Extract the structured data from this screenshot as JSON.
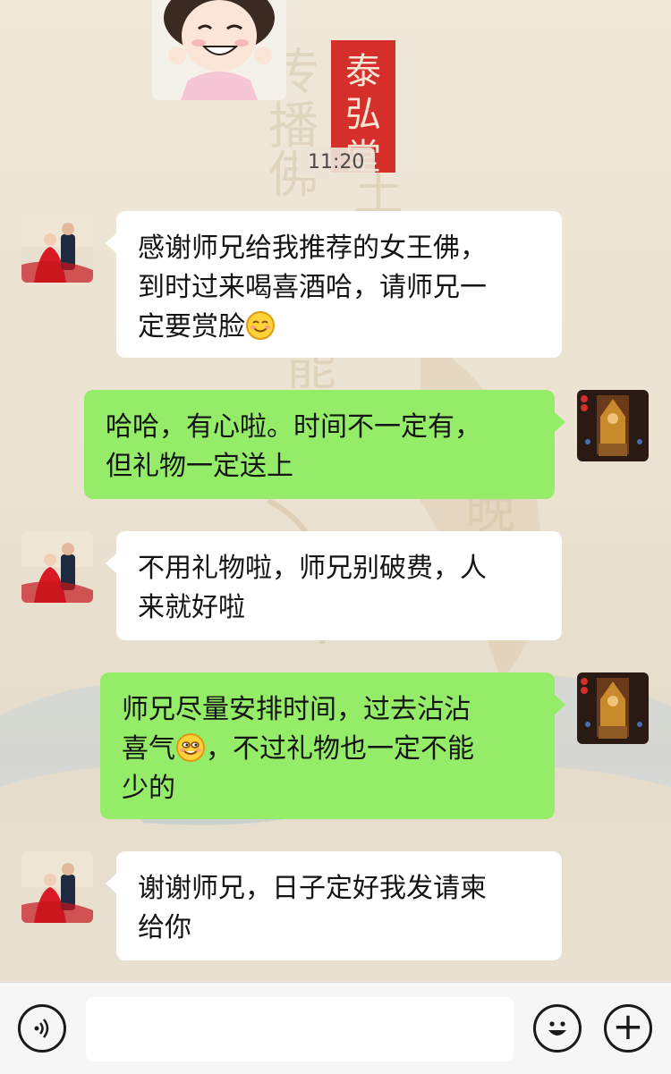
{
  "header": {
    "time": "11:20"
  },
  "background": {
    "seal_text": "泰弘堂"
  },
  "messages": [
    {
      "side": "left",
      "lines": [
        "感谢师兄给我推荐的女王佛，",
        "到时过来喝喜酒哈，请师兄一",
        "定要赏脸"
      ],
      "emoji": "smiling-face-emoji"
    },
    {
      "side": "right",
      "lines": [
        "哈哈，有心啦。时间不一定有，",
        "但礼物一定送上"
      ]
    },
    {
      "side": "left",
      "lines": [
        "不用礼物啦，师兄别破费，人",
        "来就好啦"
      ]
    },
    {
      "side": "right",
      "lines": [
        "师兄尽量安排时间，过去沾沾",
        "喜气",
        "，不过礼物也一定不能",
        "少的"
      ],
      "emoji": "grinning-sweat-emoji"
    },
    {
      "side": "left",
      "lines": [
        "谢谢师兄，日子定好我发请柬",
        "给你"
      ]
    }
  ],
  "input_bar": {
    "voice_icon": "voice-icon",
    "emoji_icon": "emoji-icon",
    "plus_icon": "plus-icon",
    "plus_label": "+"
  }
}
